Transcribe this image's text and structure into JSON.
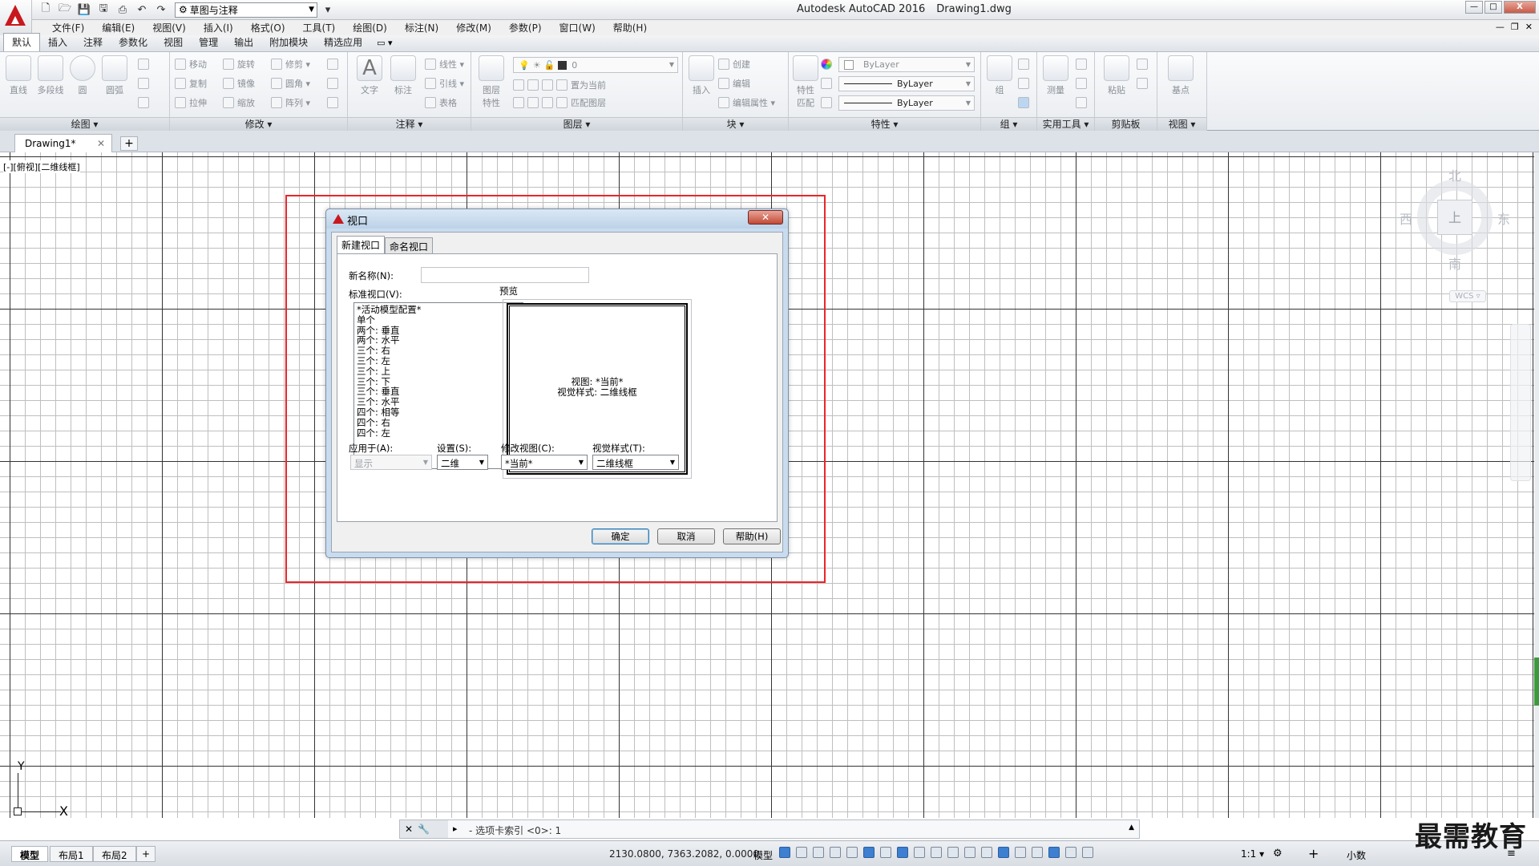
{
  "titlebar": {
    "app_name": "Autodesk AutoCAD 2016",
    "file_name": "Drawing1.dwg",
    "workspace": "草图与注释",
    "win_min": "—",
    "win_max": "□",
    "win_close": "X"
  },
  "menubar": {
    "items": [
      "文件(F)",
      "编辑(E)",
      "视图(V)",
      "插入(I)",
      "格式(O)",
      "工具(T)",
      "绘图(D)",
      "标注(N)",
      "修改(M)",
      "参数(P)",
      "窗口(W)",
      "帮助(H)"
    ],
    "mdi_controls": [
      "—",
      "❐",
      "✕"
    ]
  },
  "ribbon_tabs": {
    "items": [
      "默认",
      "插入",
      "注释",
      "参数化",
      "视图",
      "管理",
      "输出",
      "附加模块",
      "精选应用"
    ],
    "active": "默认",
    "extra": "▭ ▾"
  },
  "ribbon": {
    "draw": {
      "title": "绘图 ▾",
      "tools": [
        "直线",
        "多段线",
        "圆",
        "圆弧"
      ]
    },
    "modify": {
      "title": "修改 ▾",
      "tools": [
        "移动",
        "旋转",
        "修剪 ▾",
        "复制",
        "镜像",
        "圆角 ▾",
        "拉伸",
        "缩放",
        "阵列 ▾"
      ]
    },
    "annotation": {
      "title": "注释 ▾",
      "tools_big": [
        "文字",
        "标注"
      ],
      "tools_small": [
        "线性 ▾",
        "引线 ▾",
        "表格"
      ]
    },
    "layers": {
      "title": "图层 ▾",
      "layer_current": "0",
      "tools_big": [
        "图层\n特性"
      ],
      "tools_small": [
        "置为当前",
        "匹配图层"
      ]
    },
    "block": {
      "title": "块 ▾",
      "tools_big": [
        "插入"
      ],
      "tools_small": [
        "创建",
        "编辑",
        "编辑属性 ▾"
      ]
    },
    "properties": {
      "title": "特性 ▾",
      "tools_big": [
        "特性\n匹配"
      ],
      "color": "ByLayer",
      "linetype": "ByLayer",
      "lineweight": "ByLayer"
    },
    "group": {
      "title": "组 ▾",
      "tools_big": [
        "组"
      ]
    },
    "utilities": {
      "title": "实用工具 ▾",
      "tools_big": [
        "测量"
      ]
    },
    "clipboard": {
      "title": "剪贴板",
      "tools_big": [
        "粘贴"
      ]
    },
    "view": {
      "title": "视图 ▾",
      "tools_big": [
        "基点"
      ]
    }
  },
  "doctabs": {
    "active": "Drawing1*",
    "close": "✕",
    "add": "+"
  },
  "canvas": {
    "view_label": "[-][俯视][二维线框]",
    "viewcube": {
      "north": "北",
      "south": "南",
      "east": "东",
      "west": "西",
      "face": "上",
      "wcs": "WCS ▿"
    },
    "ucs": {
      "x": "X",
      "y": "Y"
    }
  },
  "dialog": {
    "title": "视口",
    "close": "✕",
    "tabs": [
      "新建视口",
      "命名视口"
    ],
    "active_tab": "新建视口",
    "new_name_label": "新名称(N):",
    "new_name_value": "",
    "std_viewports_label": "标准视口(V):",
    "std_viewports": [
      "*活动模型配置*",
      "单个",
      "两个: 垂直",
      "两个: 水平",
      "三个: 右",
      "三个: 左",
      "三个: 上",
      "三个: 下",
      "三个: 垂直",
      "三个: 水平",
      "四个: 相等",
      "四个: 右",
      "四个: 左"
    ],
    "preview_label": "预览",
    "preview_view": "视图: *当前*",
    "preview_style": "视觉样式: 二维线框",
    "apply_to_label": "应用于(A):",
    "apply_to_value": "显示",
    "setup_label": "设置(S):",
    "setup_value": "二维",
    "change_view_label": "修改视图(C):",
    "change_view_value": "*当前*",
    "visual_style_label": "视觉样式(T):",
    "visual_style_value": "二维线框",
    "ok": "确定",
    "cancel": "取消",
    "help": "帮助(H)"
  },
  "cmdline": {
    "prompt": "- 选项卡索引 <0>: 1",
    "close": "✕",
    "tool": "🔧",
    "up": "▲"
  },
  "statusbar": {
    "layout_tabs": [
      "模型",
      "布局1",
      "布局2"
    ],
    "active_layout": "模型",
    "add_layout": "+",
    "coords": "2130.0800, 7363.2082, 0.0000",
    "model": "模型",
    "scale": "1:1 ▾",
    "units": "小数"
  },
  "watermark": "最需教育",
  "colors": {
    "accent_red": "#c8181e",
    "highlight_red": "#e8262a",
    "dialog_frame": "#c9dcef",
    "scroll_green": "#3c9a3c"
  }
}
